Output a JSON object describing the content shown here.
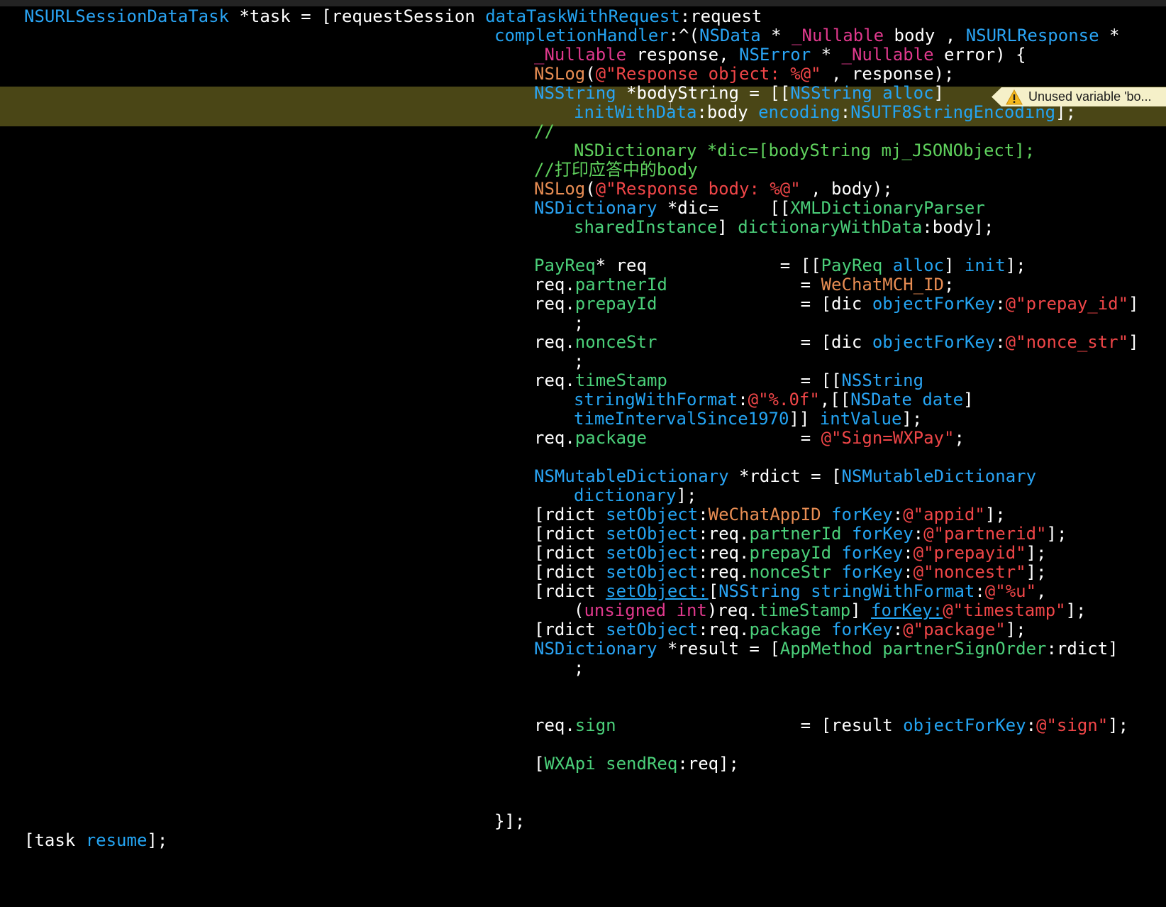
{
  "colors": {
    "background": "#000000",
    "plain": "#ffffff",
    "type": "#2aa4f4",
    "method": "#24a4f2",
    "keyword": "#e0398d",
    "string": "#f04648",
    "macro": "#e88d53",
    "property": "#4bd07a",
    "comment": "#5fd15d",
    "highlight": "#4a4616",
    "warning_bg": "#f5f0c9",
    "warning_icon": "#f5b81d"
  },
  "warning": {
    "text": "Unused variable 'bo...",
    "icon": "warning-triangle-icon"
  },
  "cursor": {
    "glyph": "⌶"
  },
  "lines": [
    {
      "tokens": [
        {
          "t": "NSURLSessionDataTask",
          "c": "type"
        },
        {
          "t": " *task = [requestSession ",
          "c": "plain"
        },
        {
          "t": "dataTaskWithRequest",
          "c": "method"
        },
        {
          "t": ":request",
          "c": "plain"
        }
      ]
    },
    {
      "tokens": [
        {
          "t": "completionHandler",
          "c": "method"
        },
        {
          "t": ":^(",
          "c": "plain"
        },
        {
          "t": "NSData",
          "c": "type"
        },
        {
          "t": " * ",
          "c": "plain"
        },
        {
          "t": "_Nullable",
          "c": "keyword"
        },
        {
          "t": " body , ",
          "c": "plain"
        },
        {
          "t": "NSURLResponse",
          "c": "type"
        },
        {
          "t": " *",
          "c": "plain"
        }
      ]
    },
    {
      "tokens": [
        {
          "t": "_Nullable",
          "c": "keyword"
        },
        {
          "t": " response, ",
          "c": "plain"
        },
        {
          "t": "NSError",
          "c": "type"
        },
        {
          "t": " * ",
          "c": "plain"
        },
        {
          "t": "_Nullable",
          "c": "keyword"
        },
        {
          "t": " error) {",
          "c": "plain"
        }
      ]
    },
    {
      "tokens": [
        {
          "t": "NSLog",
          "c": "macro"
        },
        {
          "t": "(",
          "c": "plain"
        },
        {
          "t": "@\"Response object: %@\"",
          "c": "string"
        },
        {
          "t": " , response);",
          "c": "plain"
        }
      ]
    },
    {
      "tokens": [
        {
          "t": "NSString",
          "c": "type"
        },
        {
          "t": " *bodyString = [[",
          "c": "plain"
        },
        {
          "t": "NSString",
          "c": "type"
        },
        {
          "t": " ",
          "c": "plain"
        },
        {
          "t": "alloc",
          "c": "method"
        },
        {
          "t": "]",
          "c": "plain"
        }
      ]
    },
    {
      "tokens": [
        {
          "t": "initWithData",
          "c": "method"
        },
        {
          "t": ":body ",
          "c": "plain"
        },
        {
          "t": "encoding",
          "c": "method"
        },
        {
          "t": ":",
          "c": "plain"
        },
        {
          "t": "NSUTF8StringEncoding",
          "c": "method"
        },
        {
          "t": "];",
          "c": "plain"
        }
      ]
    },
    {
      "tokens": [
        {
          "t": "//",
          "c": "comment"
        }
      ]
    },
    {
      "tokens": [
        {
          "t": "NSDictionary *dic=[bodyString mj_JSONObject];",
          "c": "comment"
        }
      ]
    },
    {
      "tokens": [
        {
          "t": "//打印应答中的body",
          "c": "comment"
        }
      ]
    },
    {
      "tokens": [
        {
          "t": "NSLog",
          "c": "macro"
        },
        {
          "t": "(",
          "c": "plain"
        },
        {
          "t": "@\"Response body: %@\"",
          "c": "string"
        },
        {
          "t": " , body);",
          "c": "plain"
        }
      ]
    },
    {
      "tokens": [
        {
          "t": "NSDictionary",
          "c": "type"
        },
        {
          "t": " *dic=     [[",
          "c": "plain"
        },
        {
          "t": "XMLDictionaryParser",
          "c": "property"
        }
      ]
    },
    {
      "tokens": [
        {
          "t": "sharedInstance",
          "c": "property"
        },
        {
          "t": "] ",
          "c": "plain"
        },
        {
          "t": "dictionaryWithData",
          "c": "property"
        },
        {
          "t": ":body];",
          "c": "plain"
        }
      ]
    },
    {
      "tokens": [
        {
          "t": "PayReq",
          "c": "property"
        },
        {
          "t": "* req             = [[",
          "c": "plain"
        },
        {
          "t": "PayReq",
          "c": "property"
        },
        {
          "t": " ",
          "c": "plain"
        },
        {
          "t": "alloc",
          "c": "method"
        },
        {
          "t": "] ",
          "c": "plain"
        },
        {
          "t": "init",
          "c": "method"
        },
        {
          "t": "];",
          "c": "plain"
        }
      ]
    },
    {
      "tokens": [
        {
          "t": "req.",
          "c": "plain"
        },
        {
          "t": "partnerId",
          "c": "property"
        },
        {
          "t": "             = ",
          "c": "plain"
        },
        {
          "t": "WeChatMCH_ID",
          "c": "macro"
        },
        {
          "t": ";",
          "c": "plain"
        }
      ]
    },
    {
      "tokens": [
        {
          "t": "req.",
          "c": "plain"
        },
        {
          "t": "prepayId",
          "c": "property"
        },
        {
          "t": "              = [dic ",
          "c": "plain"
        },
        {
          "t": "objectForKey",
          "c": "method"
        },
        {
          "t": ":",
          "c": "plain"
        },
        {
          "t": "@\"prepay_id\"",
          "c": "string"
        },
        {
          "t": "]",
          "c": "plain"
        }
      ]
    },
    {
      "tokens": [
        {
          "t": ";",
          "c": "plain"
        }
      ]
    },
    {
      "tokens": [
        {
          "t": "req.",
          "c": "plain"
        },
        {
          "t": "nonceStr",
          "c": "property"
        },
        {
          "t": "              = [dic ",
          "c": "plain"
        },
        {
          "t": "objectForKey",
          "c": "method"
        },
        {
          "t": ":",
          "c": "plain"
        },
        {
          "t": "@\"nonce_str\"",
          "c": "string"
        },
        {
          "t": "]",
          "c": "plain"
        }
      ]
    },
    {
      "tokens": [
        {
          "t": ";",
          "c": "plain"
        }
      ]
    },
    {
      "tokens": [
        {
          "t": "req.",
          "c": "plain"
        },
        {
          "t": "timeStamp",
          "c": "property"
        },
        {
          "t": "             = [[",
          "c": "plain"
        },
        {
          "t": "NSString",
          "c": "type"
        }
      ]
    },
    {
      "tokens": [
        {
          "t": "stringWithFormat",
          "c": "method"
        },
        {
          "t": ":",
          "c": "plain"
        },
        {
          "t": "@\"%.0f\"",
          "c": "string"
        },
        {
          "t": ",[[",
          "c": "plain"
        },
        {
          "t": "NSDate",
          "c": "type"
        },
        {
          "t": " ",
          "c": "plain"
        },
        {
          "t": "date",
          "c": "method"
        },
        {
          "t": "]",
          "c": "plain"
        }
      ]
    },
    {
      "tokens": [
        {
          "t": "timeIntervalSince1970",
          "c": "method"
        },
        {
          "t": "]] ",
          "c": "plain"
        },
        {
          "t": "intValue",
          "c": "method"
        },
        {
          "t": "];",
          "c": "plain"
        }
      ]
    },
    {
      "tokens": [
        {
          "t": "req.",
          "c": "plain"
        },
        {
          "t": "package",
          "c": "property"
        },
        {
          "t": "               = ",
          "c": "plain"
        },
        {
          "t": "@\"Sign=WXPay\"",
          "c": "string"
        },
        {
          "t": ";",
          "c": "plain"
        }
      ]
    },
    {
      "tokens": [
        {
          "t": "NSMutableDictionary",
          "c": "type"
        },
        {
          "t": " *rdict = [",
          "c": "plain"
        },
        {
          "t": "NSMutableDictionary",
          "c": "type"
        }
      ]
    },
    {
      "tokens": [
        {
          "t": "dictionary",
          "c": "method"
        },
        {
          "t": "];",
          "c": "plain"
        }
      ]
    },
    {
      "tokens": [
        {
          "t": "[rdict ",
          "c": "plain"
        },
        {
          "t": "setObject",
          "c": "method"
        },
        {
          "t": ":",
          "c": "plain"
        },
        {
          "t": "WeChatAppID",
          "c": "macro"
        },
        {
          "t": " ",
          "c": "plain"
        },
        {
          "t": "forKey",
          "c": "method"
        },
        {
          "t": ":",
          "c": "plain"
        },
        {
          "t": "@\"appid\"",
          "c": "string"
        },
        {
          "t": "];",
          "c": "plain"
        }
      ]
    },
    {
      "tokens": [
        {
          "t": "[rdict ",
          "c": "plain"
        },
        {
          "t": "setObject",
          "c": "method"
        },
        {
          "t": ":req.",
          "c": "plain"
        },
        {
          "t": "partnerId",
          "c": "property"
        },
        {
          "t": " ",
          "c": "plain"
        },
        {
          "t": "forKey",
          "c": "method"
        },
        {
          "t": ":",
          "c": "plain"
        },
        {
          "t": "@\"partnerid\"",
          "c": "string"
        },
        {
          "t": "];",
          "c": "plain"
        }
      ]
    },
    {
      "tokens": [
        {
          "t": "[rdict ",
          "c": "plain"
        },
        {
          "t": "setObject",
          "c": "method"
        },
        {
          "t": ":req.",
          "c": "plain"
        },
        {
          "t": "prepayId",
          "c": "property"
        },
        {
          "t": " ",
          "c": "plain"
        },
        {
          "t": "forKey",
          "c": "method"
        },
        {
          "t": ":",
          "c": "plain"
        },
        {
          "t": "@\"prepayid\"",
          "c": "string"
        },
        {
          "t": "];",
          "c": "plain"
        }
      ]
    },
    {
      "tokens": [
        {
          "t": "[rdict ",
          "c": "plain"
        },
        {
          "t": "setObject",
          "c": "method"
        },
        {
          "t": ":req.",
          "c": "plain"
        },
        {
          "t": "nonceStr",
          "c": "property"
        },
        {
          "t": " ",
          "c": "plain"
        },
        {
          "t": "forKey",
          "c": "method"
        },
        {
          "t": ":",
          "c": "plain"
        },
        {
          "t": "@\"noncestr\"",
          "c": "string"
        },
        {
          "t": "];",
          "c": "plain"
        }
      ]
    },
    {
      "tokens": [
        {
          "t": "[rdict ",
          "c": "plain"
        },
        {
          "t": "setObject:",
          "c": "method",
          "u": true
        },
        {
          "t": "[",
          "c": "plain"
        },
        {
          "t": "NSString",
          "c": "type"
        },
        {
          "t": " ",
          "c": "plain"
        },
        {
          "t": "stringWithFormat",
          "c": "method"
        },
        {
          "t": ":",
          "c": "plain"
        },
        {
          "t": "@\"%u\"",
          "c": "string"
        },
        {
          "t": ",",
          "c": "plain"
        }
      ]
    },
    {
      "tokens": [
        {
          "t": "(",
          "c": "plain"
        },
        {
          "t": "unsigned int",
          "c": "keyword"
        },
        {
          "t": ")req.",
          "c": "plain"
        },
        {
          "t": "timeStamp",
          "c": "property"
        },
        {
          "t": "] ",
          "c": "plain"
        },
        {
          "t": "forKey:",
          "c": "method",
          "u": true
        },
        {
          "t": "@\"timestamp\"",
          "c": "string"
        },
        {
          "t": "];",
          "c": "plain"
        }
      ]
    },
    {
      "tokens": [
        {
          "t": "[rdict ",
          "c": "plain"
        },
        {
          "t": "setObject",
          "c": "method"
        },
        {
          "t": ":req.",
          "c": "plain"
        },
        {
          "t": "package",
          "c": "property"
        },
        {
          "t": " ",
          "c": "plain"
        },
        {
          "t": "forKey",
          "c": "method"
        },
        {
          "t": ":",
          "c": "plain"
        },
        {
          "t": "@\"package\"",
          "c": "string"
        },
        {
          "t": "];",
          "c": "plain"
        }
      ]
    },
    {
      "tokens": [
        {
          "t": "NSDictionary",
          "c": "type"
        },
        {
          "t": " *result = [",
          "c": "plain"
        },
        {
          "t": "AppMethod",
          "c": "property"
        },
        {
          "t": " ",
          "c": "plain"
        },
        {
          "t": "partnerSignOrder",
          "c": "property"
        },
        {
          "t": ":rdict]",
          "c": "plain"
        }
      ]
    },
    {
      "tokens": [
        {
          "t": ";",
          "c": "plain"
        }
      ]
    },
    {
      "tokens": [
        {
          "t": "req.",
          "c": "plain"
        },
        {
          "t": "sign",
          "c": "property"
        },
        {
          "t": "                  = [result ",
          "c": "plain"
        },
        {
          "t": "objectForKey",
          "c": "method"
        },
        {
          "t": ":",
          "c": "plain"
        },
        {
          "t": "@\"sign\"",
          "c": "string"
        },
        {
          "t": "];",
          "c": "plain"
        }
      ]
    },
    {
      "tokens": [
        {
          "t": "[",
          "c": "plain"
        },
        {
          "t": "WXApi",
          "c": "property"
        },
        {
          "t": " ",
          "c": "plain"
        },
        {
          "t": "sendReq",
          "c": "property"
        },
        {
          "t": ":req];",
          "c": "plain"
        }
      ]
    },
    {
      "tokens": [
        {
          "t": "}];",
          "c": "plain"
        }
      ]
    },
    {
      "tokens": [
        {
          "t": "[task ",
          "c": "plain"
        },
        {
          "t": "resume",
          "c": "method"
        },
        {
          "t": "];",
          "c": "plain"
        }
      ]
    }
  ]
}
